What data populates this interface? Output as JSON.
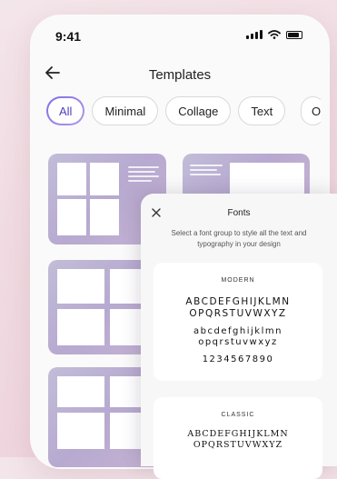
{
  "status": {
    "time": "9:41"
  },
  "header": {
    "title": "Templates"
  },
  "chips": [
    "All",
    "Minimal",
    "Collage",
    "Text",
    "Ot"
  ],
  "sheet": {
    "title": "Fonts",
    "description": "Select a font group to style all the text and typography in your design",
    "groups": [
      {
        "label": "MODERN",
        "upper1": "ABCDEFGHIJKLMN",
        "upper2": "OPQRSTUVWXYZ",
        "lower1": "abcdefghijklmn",
        "lower2": "opqrstuvwxyz",
        "digits": "1234567890"
      },
      {
        "label": "CLASSIC",
        "upper1": "ABCDEFGHIJKLMN",
        "upper2": "OPQRSTUVWXYZ"
      }
    ]
  },
  "colors": {
    "accent": "#6c5ce7",
    "template_gradient": "#b7a9d0"
  }
}
